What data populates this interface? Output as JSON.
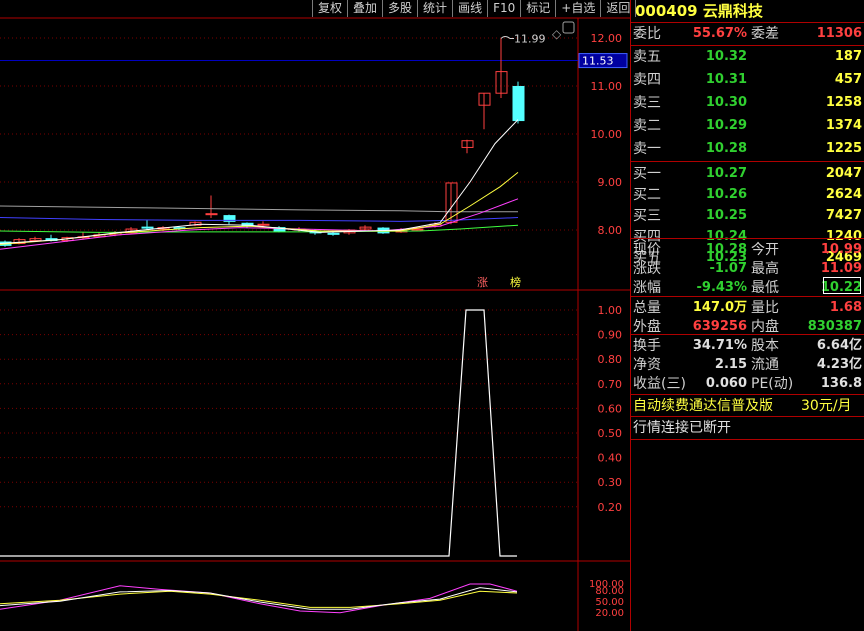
{
  "toolbar": [
    "复权",
    "叠加",
    "多股",
    "统计",
    "画线",
    "F10",
    "标记",
    "+自选",
    "返回"
  ],
  "stock": {
    "code": "000409",
    "name": "云鼎科技"
  },
  "colors": {
    "up": "#ff4040",
    "down": "#54ffff",
    "ma5": "#ffffff",
    "ma10": "#ffff40",
    "ma20": "#ff40ff",
    "ma60": "#40ff40",
    "ma_long": "#4040ff",
    "ma_gray": "#a0a0a0"
  },
  "price_axis": {
    "ticks": [
      "12.00",
      "11.00",
      "10.00",
      "9.00",
      "8.00"
    ],
    "current_tag": "11.53",
    "high_label": "11.99"
  },
  "tags": {
    "limit": "涨",
    "list": "榜"
  },
  "indicator_axis": {
    "ticks": [
      "1.00",
      "0.90",
      "0.80",
      "0.70",
      "0.60",
      "0.50",
      "0.40",
      "0.30",
      "0.20"
    ]
  },
  "kdj_axis": {
    "ticks": [
      "100.00",
      "80.00",
      "50.00",
      "20.00"
    ]
  },
  "quote": {
    "weibi_label": "委比",
    "weibi": "55.67%",
    "weicha_label": "委差",
    "weicha": "11306",
    "sells": [
      {
        "label": "卖五",
        "price": "10.32",
        "vol": "187"
      },
      {
        "label": "卖四",
        "price": "10.31",
        "vol": "457"
      },
      {
        "label": "卖三",
        "price": "10.30",
        "vol": "1258"
      },
      {
        "label": "卖二",
        "price": "10.29",
        "vol": "1374"
      },
      {
        "label": "卖一",
        "price": "10.28",
        "vol": "1225"
      }
    ],
    "buys": [
      {
        "label": "买一",
        "price": "10.27",
        "vol": "2047"
      },
      {
        "label": "买二",
        "price": "10.26",
        "vol": "2624"
      },
      {
        "label": "买三",
        "price": "10.25",
        "vol": "7427"
      },
      {
        "label": "买四",
        "price": "10.24",
        "vol": "1240"
      },
      {
        "label": "买五",
        "price": "10.23",
        "vol": "2469"
      }
    ],
    "stats1": [
      {
        "l1": "现价",
        "v1": "10.28",
        "c1": "green",
        "l2": "今开",
        "v2": "10.99",
        "c2": "red"
      },
      {
        "l1": "涨跌",
        "v1": "-1.07",
        "c1": "green",
        "l2": "最高",
        "v2": "11.09",
        "c2": "red"
      },
      {
        "l1": "涨幅",
        "v1": "-9.43%",
        "c1": "green",
        "l2": "最低",
        "v2": "10.22",
        "c2": "green"
      }
    ],
    "stats2": [
      {
        "l1": "总量",
        "v1": "147.0万",
        "c1": "yellow",
        "l2": "量比",
        "v2": "1.68",
        "c2": "red"
      },
      {
        "l1": "外盘",
        "v1": "639256",
        "c1": "red",
        "l2": "内盘",
        "v2": "830387",
        "c2": "green"
      }
    ],
    "stats3": [
      {
        "l1": "换手",
        "v1": "34.71%",
        "c1": "white",
        "l2": "股本",
        "v2": "6.64亿",
        "c2": "white"
      },
      {
        "l1": "净资",
        "v1": "2.15",
        "c1": "white",
        "l2": "流通",
        "v2": "4.23亿",
        "c2": "white"
      },
      {
        "l1": "收益(三)",
        "v1": "0.060",
        "c1": "white",
        "l2": "PE(动)",
        "v2": "136.8",
        "c2": "white"
      }
    ],
    "notice": "自动续费通达信普及版",
    "notice_price": "30元/月",
    "status": "行情连接已断开"
  }
}
